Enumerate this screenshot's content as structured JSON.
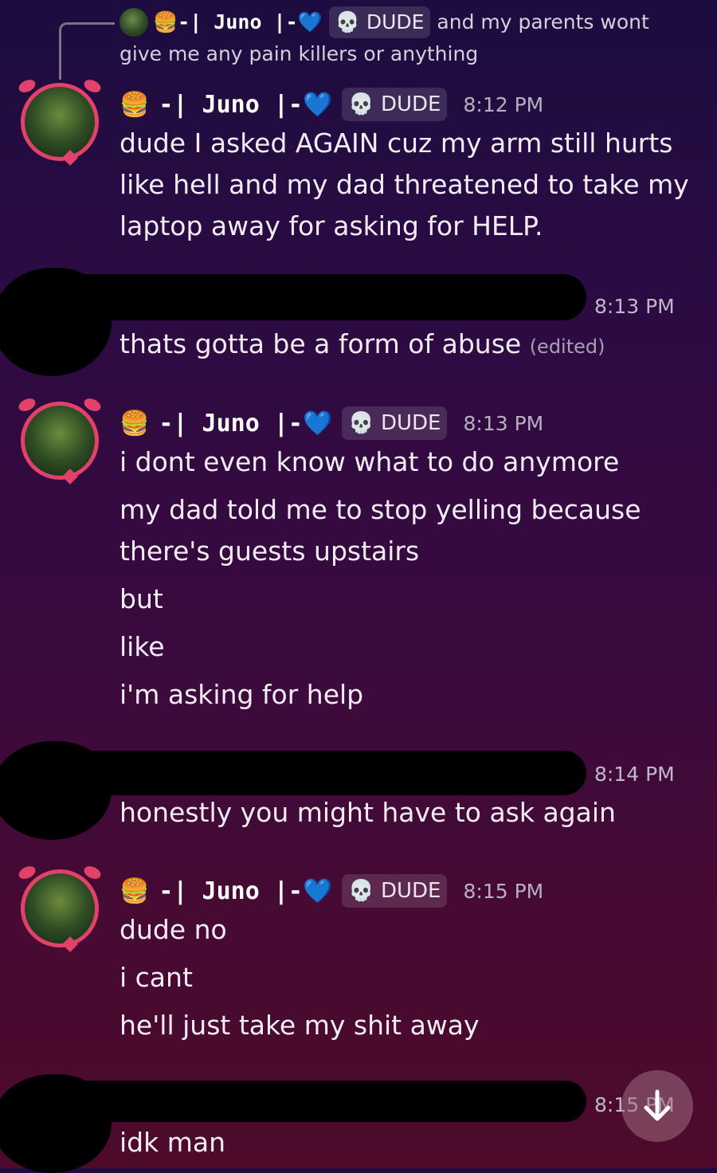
{
  "user": {
    "name": "-| Juno |-",
    "prefix_emoji": "🍔",
    "heart": "💙",
    "tag_icon": "💀",
    "tag": "DUDE"
  },
  "reply": {
    "text": "and my parents wont give me any pain killers or anything"
  },
  "groups": [
    {
      "time": "8:12 PM",
      "lines": [
        "dude I asked AGAIN cuz my arm still hurts",
        "like hell and my dad threatened to take my",
        "laptop away for asking for HELP."
      ]
    },
    {
      "time": "8:13 PM",
      "lines": [
        "i dont even know what to do anymore",
        "my dad told me to stop yelling because",
        "there's guests upstairs",
        "but",
        "like",
        "i'm asking for help"
      ]
    },
    {
      "time": "8:15 PM",
      "lines": [
        "dude no",
        "i cant",
        "he'll just take my shit away"
      ]
    }
  ],
  "redacted_messages": [
    {
      "time": "8:13 PM",
      "text": "thats gotta be a form of abuse",
      "edited": "(edited)"
    },
    {
      "time": "8:14 PM",
      "text": "honestly you might have to ask again"
    },
    {
      "time": "8:15 PM",
      "text": "idk man"
    }
  ],
  "colors": {
    "accent": "#e2426a",
    "heart": "#1e90ff"
  },
  "icons": {
    "scroll_down": "arrow-down-icon"
  }
}
